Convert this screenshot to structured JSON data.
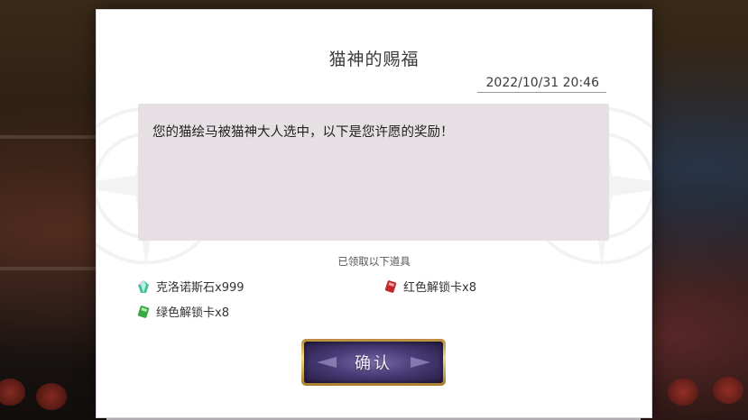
{
  "dialog": {
    "title": "猫神的赐福",
    "date": "2022/10/31 20:46",
    "message": "您的猫绘马被猫神大人选中，以下是您许愿的奖励！",
    "received_label": "已领取以下道具",
    "items": [
      {
        "name": "克洛诺斯石x999",
        "icon": "chronos-stone-icon",
        "color": "#3fbf9a"
      },
      {
        "name": "红色解锁卡x8",
        "icon": "red-unlock-card-icon",
        "color": "#c0282e"
      },
      {
        "name": "绿色解锁卡x8",
        "icon": "green-unlock-card-icon",
        "color": "#3aa845"
      }
    ],
    "confirm_label": "确认"
  },
  "colors": {
    "button_frame": "#d9b25a",
    "button_fill": "#4a3c78",
    "message_bg": "#e6dfe4"
  }
}
